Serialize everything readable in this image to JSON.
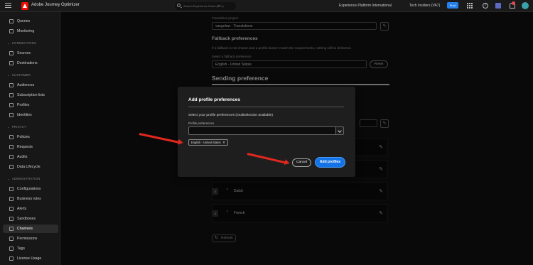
{
  "topbar": {
    "app_title": "Adobe Journey Optimizer",
    "search_placeholder": "Search Experience Cloud (⌘+/)",
    "org": "Experience Platform International",
    "sandbox": "Tech Insiders (VA7)",
    "env_badge": "Prod"
  },
  "sidebar": {
    "items_top": [
      {
        "label": "Queries",
        "icon": "query-icon"
      },
      {
        "label": "Monitoring",
        "icon": "monitor-icon"
      }
    ],
    "sections": [
      {
        "title": "CONNECTIONS",
        "items": [
          {
            "label": "Sources"
          },
          {
            "label": "Destinations"
          }
        ]
      },
      {
        "title": "CUSTOMER",
        "items": [
          {
            "label": "Audiences"
          },
          {
            "label": "Subscription lists"
          },
          {
            "label": "Profiles"
          },
          {
            "label": "Identities"
          }
        ]
      },
      {
        "title": "PRIVACY",
        "items": [
          {
            "label": "Policies"
          },
          {
            "label": "Requests"
          },
          {
            "label": "Audits"
          },
          {
            "label": "Data Lifecycle"
          }
        ]
      },
      {
        "title": "ADMINISTRATION",
        "items": [
          {
            "label": "Configurations"
          },
          {
            "label": "Business rules"
          },
          {
            "label": "Alerts"
          },
          {
            "label": "Sandboxes"
          },
          {
            "label": "Channels",
            "active": true
          },
          {
            "label": "Permissions"
          },
          {
            "label": "Tags"
          },
          {
            "label": "License Usage"
          }
        ]
      }
    ]
  },
  "form": {
    "translation_project_label": "Translation project",
    "translation_project_value": "vangeluw - Translations",
    "fallback_title": "Fallback preferences",
    "fallback_help": "If a fallback is not chosen and a profile doesn't match the requirements, nothing will be delivered.",
    "fallback_select_label": "Select a fallback preference",
    "fallback_select_value": "English - United States",
    "reset_label": "Reset",
    "sending_title": "Sending preference",
    "languages": [
      {
        "num": "3",
        "name": "Dutch"
      },
      {
        "num": "4",
        "name": "French"
      }
    ],
    "refresh_label": "Refresh"
  },
  "dialog": {
    "title": "Add profile preferences",
    "subtitle": "Select your profile preferences (multiselection available)",
    "field_label": "Profile preferences",
    "field_value": "",
    "tag_label": "English - United States",
    "cancel_label": "Cancel",
    "add_label": "Add profiles"
  },
  "colors": {
    "accent": "#1473e6",
    "annotation_arrow": "#e0281f"
  }
}
